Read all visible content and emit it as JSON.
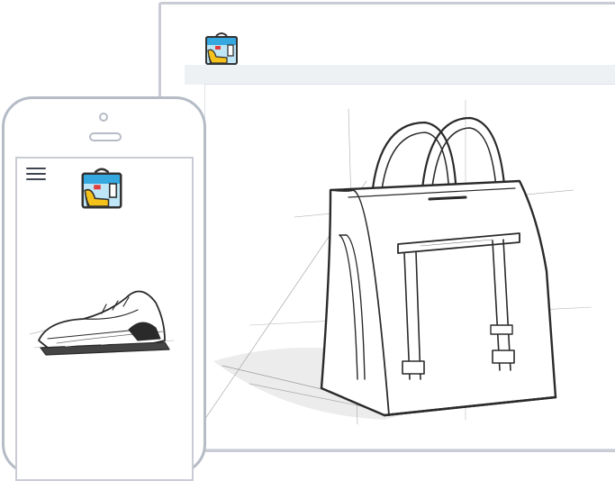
{
  "desktop": {
    "logo_icon": "shoe-bag-logo-icon",
    "sketch": "handbag-sketch"
  },
  "phone": {
    "menu_icon": "hamburger-menu-icon",
    "logo_icon": "shoe-bag-logo-icon",
    "sketch": "sneaker-sketch"
  },
  "colors": {
    "logo_blue": "#35a8e0",
    "logo_yellow": "#f5c21b",
    "logo_red": "#e23d3d",
    "frame_border": "#c9ccd4",
    "nav_bar": "#eef1f4",
    "sketch_ink": "#2a2a2a"
  }
}
